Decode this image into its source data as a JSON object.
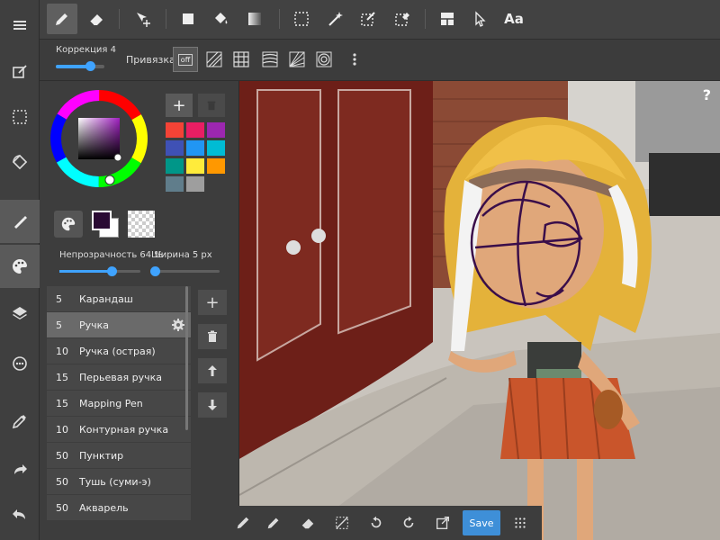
{
  "rail": {
    "items": [
      {
        "icon": "menu-icon"
      },
      {
        "icon": "edit-window-icon"
      },
      {
        "icon": "selection-icon"
      },
      {
        "icon": "rotate-canvas-icon"
      },
      {
        "icon": "brush-icon"
      },
      {
        "icon": "palette-icon"
      },
      {
        "icon": "layers-icon"
      },
      {
        "icon": "material-icon"
      },
      {
        "icon": "eyedropper-icon"
      },
      {
        "icon": "redo-icon"
      },
      {
        "icon": "undo-icon"
      }
    ]
  },
  "toolbar": {
    "text_tool_label": "Aa"
  },
  "subbar": {
    "correction_label": "Коррекция 4",
    "correction_value": 0.7,
    "snap_label": "Привязка",
    "snap_off_label": "off"
  },
  "colors": {
    "accent": "#3fa3ff",
    "current_color": "#2a0a33",
    "swatches": [
      "#f44336",
      "#e91e63",
      "#9c27b0",
      "#3f51b5",
      "#2196f3",
      "#00bcd4",
      "#009688",
      "#ffeb3b",
      "#ff9800",
      "#607d8b",
      "#9e9e9e"
    ],
    "add_label": "+"
  },
  "sliders": {
    "opacity_label": "Непрозрачность 64 %",
    "opacity_value": 0.64,
    "width_label": "Ширина 5 px",
    "width_value": 0.05
  },
  "brushes": [
    {
      "size": "5",
      "name": "Карандаш"
    },
    {
      "size": "5",
      "name": "Ручка",
      "selected": true
    },
    {
      "size": "10",
      "name": "Ручка (острая)"
    },
    {
      "size": "15",
      "name": "Перьевая ручка"
    },
    {
      "size": "15",
      "name": "Mapping Pen"
    },
    {
      "size": "10",
      "name": "Контурная ручка"
    },
    {
      "size": "50",
      "name": "Пунктир"
    },
    {
      "size": "50",
      "name": "Тушь (суми-э)"
    },
    {
      "size": "50",
      "name": "Акварель"
    }
  ],
  "list_actions": {
    "add": "+"
  },
  "canvas": {
    "help_label": "?"
  },
  "bottombar": {
    "save_label": "Save"
  }
}
